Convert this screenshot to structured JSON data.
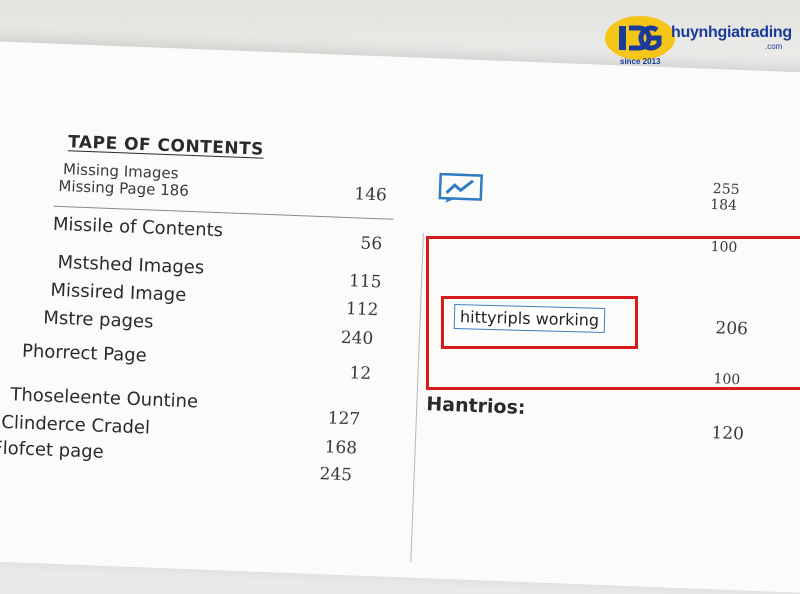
{
  "logo": {
    "name": "huynhgiatrading",
    "domain_suffix": ".com",
    "since": "since 2013",
    "colors": {
      "badge": "#f5c518",
      "text": "#1a3b9a"
    }
  },
  "toc": {
    "title": "TAPE OF CONTENTS",
    "header_line1": "Missing Images",
    "header_line2": "Missing Page 186",
    "header_num": "146",
    "rows": [
      {
        "label": "Missile of Contents",
        "page": "56"
      },
      {
        "label": "Mstshed Images",
        "page": "115"
      },
      {
        "label": "Missired Image",
        "page": "112"
      },
      {
        "label": "Mstre pages",
        "page": "240"
      },
      {
        "label": "Phorrect Page",
        "page": "12"
      },
      {
        "label": "Thoseleente Ountine",
        "page": "127"
      },
      {
        "label": "Clinderce Cradel",
        "page": "168"
      },
      {
        "label": "Flofcet page",
        "page": "245"
      }
    ]
  },
  "right": {
    "icon": "chart-icon",
    "num_a": "255",
    "num_b": "184",
    "num_c": "100",
    "highlight_text": "hittyripls working",
    "highlight_num": "206",
    "num_d": "100",
    "section_label": "Hantrios:",
    "section_num": "120"
  },
  "colors": {
    "annotation_red": "#d81b1b",
    "annotation_blue": "#3a7fc1",
    "icon_blue": "#2f7cc0"
  }
}
